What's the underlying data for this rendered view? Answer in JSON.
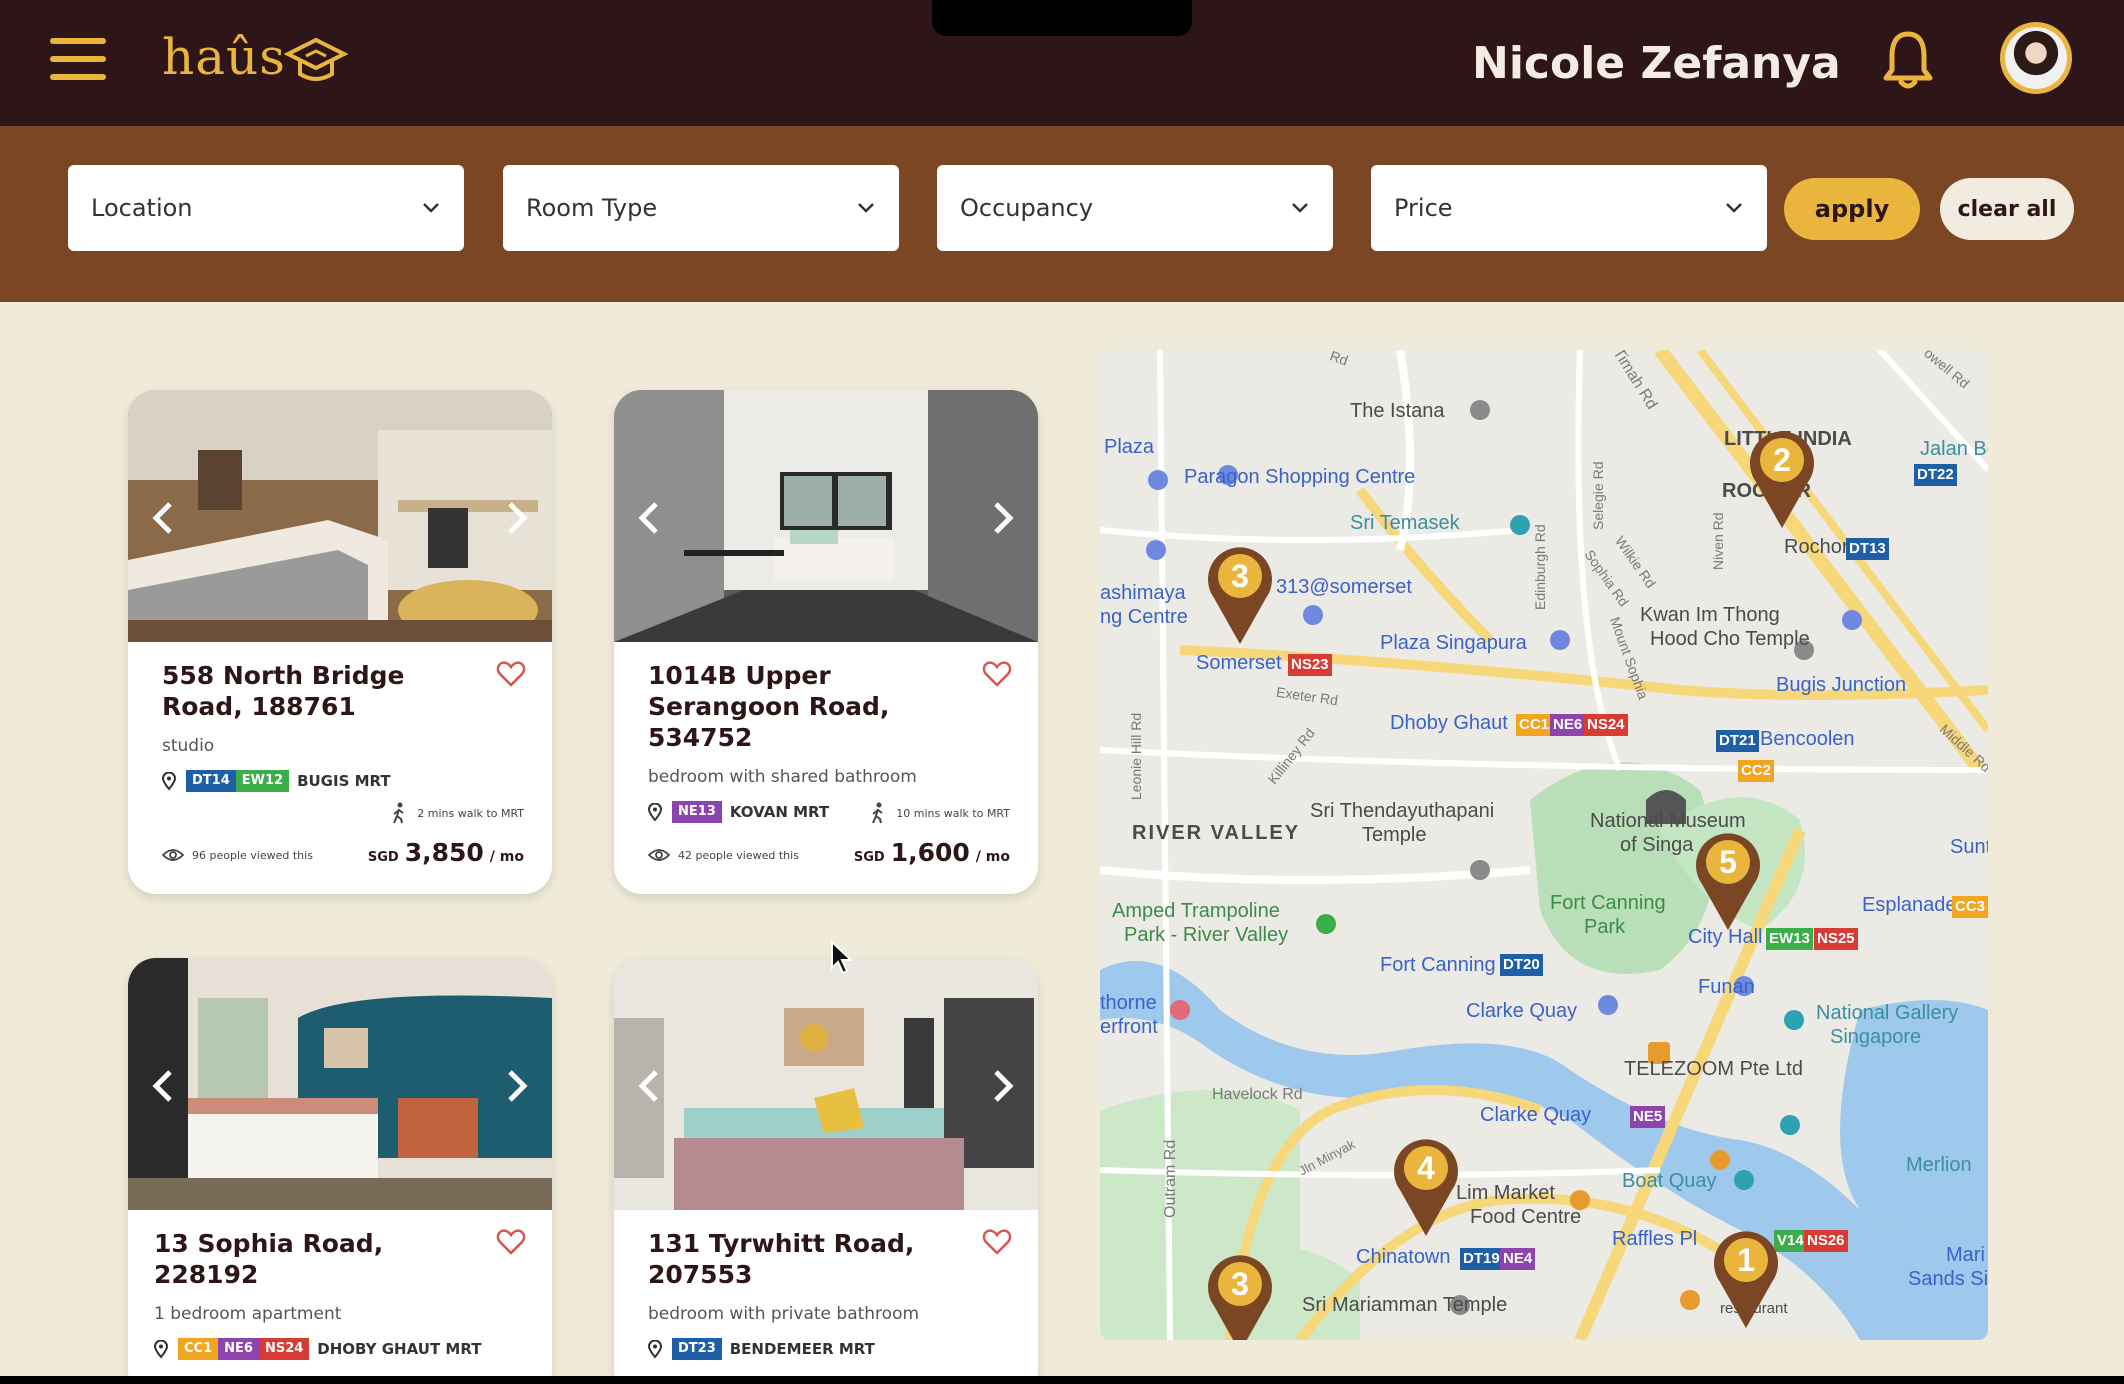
{
  "header": {
    "logo_text": "haûs",
    "user_name": "Nicole Zefanya"
  },
  "filters": {
    "location": "Location",
    "room_type": "Room Type",
    "occupancy": "Occupancy",
    "price": "Price",
    "apply_label": "apply",
    "clear_label": "clear all"
  },
  "listings": [
    {
      "title": "558 North Bridge Road, 188761",
      "type": "studio",
      "lines": [
        {
          "code": "DT14",
          "color": "#1f5fa8"
        },
        {
          "code": "EW12",
          "color": "#3cae49"
        }
      ],
      "mrt": "BUGIS MRT",
      "walk": "2 mins walk to MRT",
      "views": "96 people viewed this",
      "currency": "SGD",
      "price": "3,850",
      "unit": "/ mo"
    },
    {
      "title": "1014B Upper Serangoon Road, 534752",
      "type": "bedroom with shared bathroom",
      "lines": [
        {
          "code": "NE13",
          "color": "#8e44ad"
        }
      ],
      "mrt": "KOVAN MRT",
      "walk": "10 mins walk to MRT",
      "views": "42 people viewed this",
      "currency": "SGD",
      "price": "1,600",
      "unit": "/ mo"
    },
    {
      "title": "13 Sophia Road, 228192",
      "type": "1 bedroom apartment",
      "lines": [
        {
          "code": "CC1",
          "color": "#f2a51f"
        },
        {
          "code": "NE6",
          "color": "#8e44ad"
        },
        {
          "code": "NS24",
          "color": "#d83a34"
        }
      ],
      "mrt": "DHOBY GHAUT MRT"
    },
    {
      "title": "131 Tyrwhitt Road, 207553",
      "type": "bedroom with private bathroom",
      "lines": [
        {
          "code": "DT23",
          "color": "#1f5fa8"
        }
      ],
      "mrt": "BENDEMEER MRT"
    }
  ],
  "map": {
    "places": {
      "the_istana": "The Istana",
      "little_india": "LITTLE INDIA",
      "jalan_besar": "Jalan Besa",
      "plaza": "Plaza",
      "paragon": "Paragon Shopping Centre",
      "sri_temasek": "Sri Temasek",
      "rochor": "ROCHOR",
      "rochor_stn": "Rochor",
      "takashimaya": "ashimaya",
      "takashimaya2": "ng Centre",
      "somerset313": "313@somerset",
      "kwan_im": "Kwan Im Thong",
      "kwan_im2": "Hood Cho Temple",
      "plaza_sg": "Plaza Singapura",
      "somerset": "Somerset",
      "bugis_junction": "Bugis Junction",
      "dhoby": "Dhoby Ghaut",
      "bencoolen": "Bencoolen",
      "river_valley": "RIVER VALLEY",
      "sri_then": "Sri Thendayuthapani",
      "temple": "Temple",
      "national_museum": "National Museum",
      "of_singa": "of Singa",
      "suntec": "Suntec",
      "fort_canning_park": "Fort Canning",
      "park": "Park",
      "esplanade": "Esplanade",
      "amped": "Amped Trampoline",
      "amped2": "Park - River Valley",
      "city_hall": "City Hall",
      "fort_canning": "Fort Canning",
      "funan": "Funan",
      "thorne": "thorne",
      "erfront": "erfront",
      "clarke_quay": "Clarke Quay",
      "national_gallery": "National Gallery",
      "singapore": "Singapore",
      "telezoom": "TELEZOOM Pte Ltd",
      "havelock": "Havelock Rd",
      "clarke_quay_stn": "Clarke Quay",
      "merlion": "Merlion",
      "boat_quay": "Boat Quay",
      "lim_market": "Lim Market",
      "food_centre": "Food Centre",
      "raffles": "Raffles Pl",
      "marina_sands": "Mari",
      "marina_sands2": "Sands Sin",
      "chinatown": "Chinatown",
      "sri_mariamman": "Sri Mariamman Temple",
      "restaurant": "restaurant",
      "outram": "Outram Rd",
      "jln_minyak": "Jln Minyak",
      "exeter": "Exeter Rd",
      "killiney": "Killiney Rd",
      "leonie": "Leonie Hill Rd",
      "edinburgh": "Edinburgh Rd",
      "sophia": "Sophia Rd",
      "wilkie": "Wilkie Rd",
      "niven": "Niven Rd",
      "mount_sophia": "Mount Sophia",
      "selegie": "Selegie Rd",
      "timah": "Timah Rd",
      "middle": "Middle Rd",
      "owell": "owell Rd",
      "rd": "Rd"
    },
    "stations": {
      "dt22": "DT22",
      "dt13": "DT13",
      "ns23": "NS23",
      "cc1": "CC1",
      "ne6": "NE6",
      "ns24": "NS24",
      "dt21": "DT21",
      "cc2": "CC2",
      "cc3": "CC3",
      "ew13": "EW13",
      "ns25": "NS25",
      "dt20": "DT20",
      "ne5": "NE5",
      "ew14": "V14",
      "ns26": "NS26",
      "dt19": "DT19",
      "ne4": "NE4"
    },
    "markers": [
      "1",
      "2",
      "3",
      "3",
      "4",
      "5"
    ]
  },
  "colors": {
    "header_bg": "#2e1618",
    "filter_bg": "#7b4624",
    "accent": "#e9b53c",
    "page_bg": "#f0ead8",
    "marker": "#7b4624"
  }
}
